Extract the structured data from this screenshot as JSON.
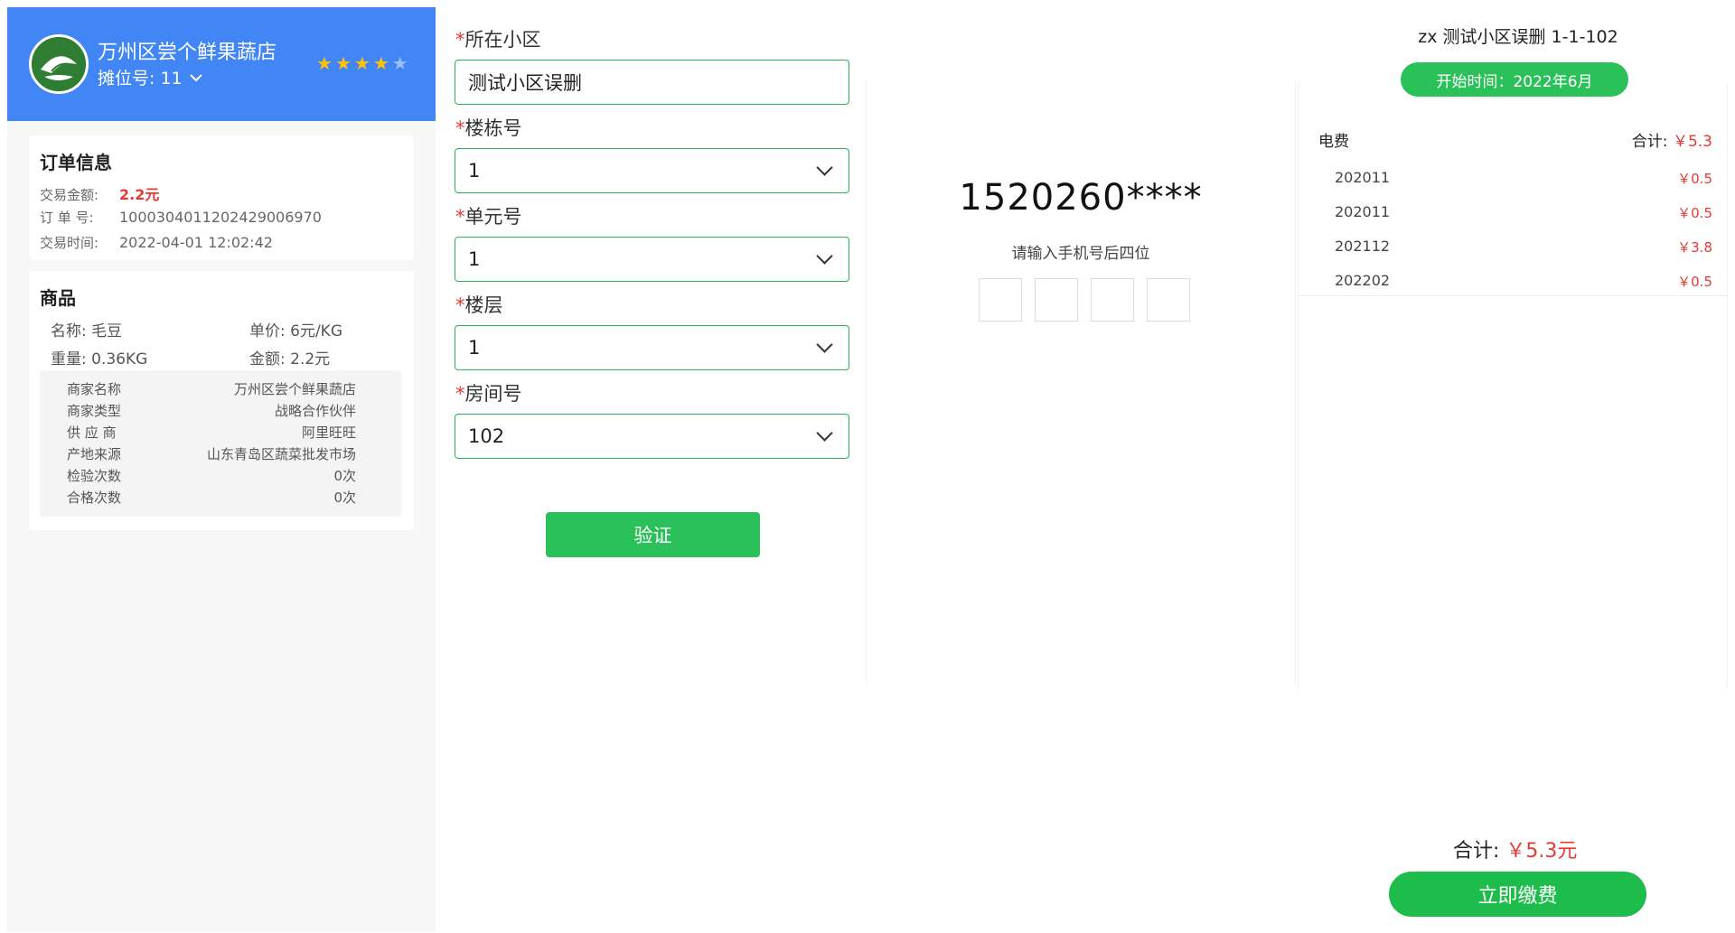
{
  "merchant": {
    "name": "万州区尝个鲜果蔬店",
    "stall_label": "摊位号: 11",
    "rating": 4,
    "rating_max": 5,
    "colors": {
      "header": "#4285f4",
      "star": "#ffc107"
    }
  },
  "order": {
    "title": "订单信息",
    "amount_label": "交易金额:",
    "amount_value": "2.2元",
    "order_no_label": "订 单 号:",
    "order_no_value": "10003040112024290069​70",
    "time_label": "交易时间:",
    "time_value": "2022-04-01 12:02:42"
  },
  "goods": {
    "title": "商品",
    "name_text": "名称:  毛豆",
    "price_text": "单价:  6元/KG",
    "weight_text": "重量:  0.36KG",
    "total_text": "金额:  2.2元",
    "details": [
      {
        "k": "商家名称",
        "v": "万州区尝个鲜果蔬店"
      },
      {
        "k": "商家类型",
        "v": "战略合作伙伴"
      },
      {
        "k": "供 应 商",
        "v": "阿里旺旺"
      },
      {
        "k": "产地来源",
        "v": "山东青岛区蔬菜批发市场"
      },
      {
        "k": "检验次数",
        "v": "0次"
      },
      {
        "k": "合格次数",
        "v": "0次"
      }
    ]
  },
  "form": {
    "required_mark": "*",
    "community_label": "所在小区",
    "community_value": "测试小区误删",
    "building_label": "楼栋号",
    "building_value": "1",
    "unit_label": "单元号",
    "unit_value": "1",
    "floor_label": "楼层",
    "floor_value": "1",
    "room_label": "房间号",
    "room_value": "102",
    "verify_label": "验证",
    "accent": "#2bc15a"
  },
  "phone": {
    "masked_number": "1520260****",
    "hint": "请输入手机号后四位"
  },
  "bill": {
    "header": "zx    测试小区误删 1-1-102",
    "start_time": "开始时间：2022年6月",
    "category": "电费",
    "total_label": "合计:",
    "total_value": "￥5.3",
    "rows": [
      {
        "period": "202011",
        "amount": "￥0.5"
      },
      {
        "period": "202011",
        "amount": "￥0.5"
      },
      {
        "period": "202112",
        "amount": "￥3.8"
      },
      {
        "period": "202202",
        "amount": "￥0.5"
      }
    ]
  },
  "footer": {
    "sum_label": "合计:",
    "sum_value": "￥5.3元",
    "pay_label": "立即缴费",
    "price_color": "#e53935"
  }
}
